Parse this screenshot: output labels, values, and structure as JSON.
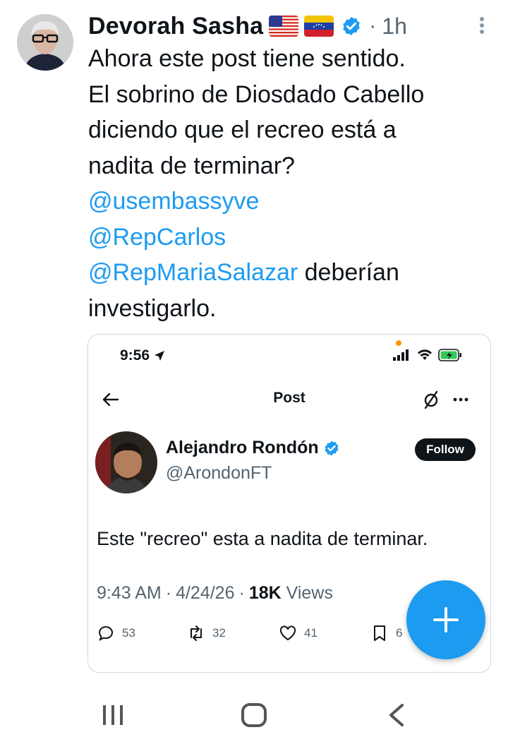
{
  "tweet": {
    "author": "Devorah Sasha",
    "separator": "·",
    "time": "1h",
    "text_line1": "Ahora este post tiene sentido.",
    "text_line2": "El sobrino de Diosdado Cabello",
    "text_line3": "diciendo que el recreo está a",
    "text_line4": "nadita de terminar?",
    "mention1": "@usembassyve",
    "mention2": "@RepCarlos",
    "mention3": "@RepMariaSalazar",
    "text_after_mention3": " deberían",
    "text_line8": "investigarlo."
  },
  "embedded": {
    "status_time": "9:56",
    "header_title": "Post",
    "author": "Alejandro Rondón",
    "handle": "@ArondonFT",
    "follow_label": "Follow",
    "text": "Este \"recreo\" esta a nadita de terminar.",
    "time": "9:43 AM",
    "date": "4/24/26",
    "separator": "·",
    "views_count": "18K",
    "views_label": "Views",
    "replies": "53",
    "reposts": "32",
    "likes": "41",
    "bookmarks": "6"
  },
  "colors": {
    "accent": "#1d9bf0",
    "text": "#0f1419",
    "secondary": "#536471"
  },
  "icons": [
    "more-vert-icon",
    "verified-icon",
    "us-flag-icon",
    "venezuela-flag-icon",
    "location-arrow-icon",
    "signal-icon",
    "wifi-icon",
    "battery-icon",
    "back-arrow-icon",
    "grok-slash-icon",
    "more-horiz-icon",
    "reply-icon",
    "repost-icon",
    "like-icon",
    "bookmark-icon",
    "plus-icon",
    "recent-apps-icon",
    "home-icon",
    "nav-back-icon"
  ]
}
